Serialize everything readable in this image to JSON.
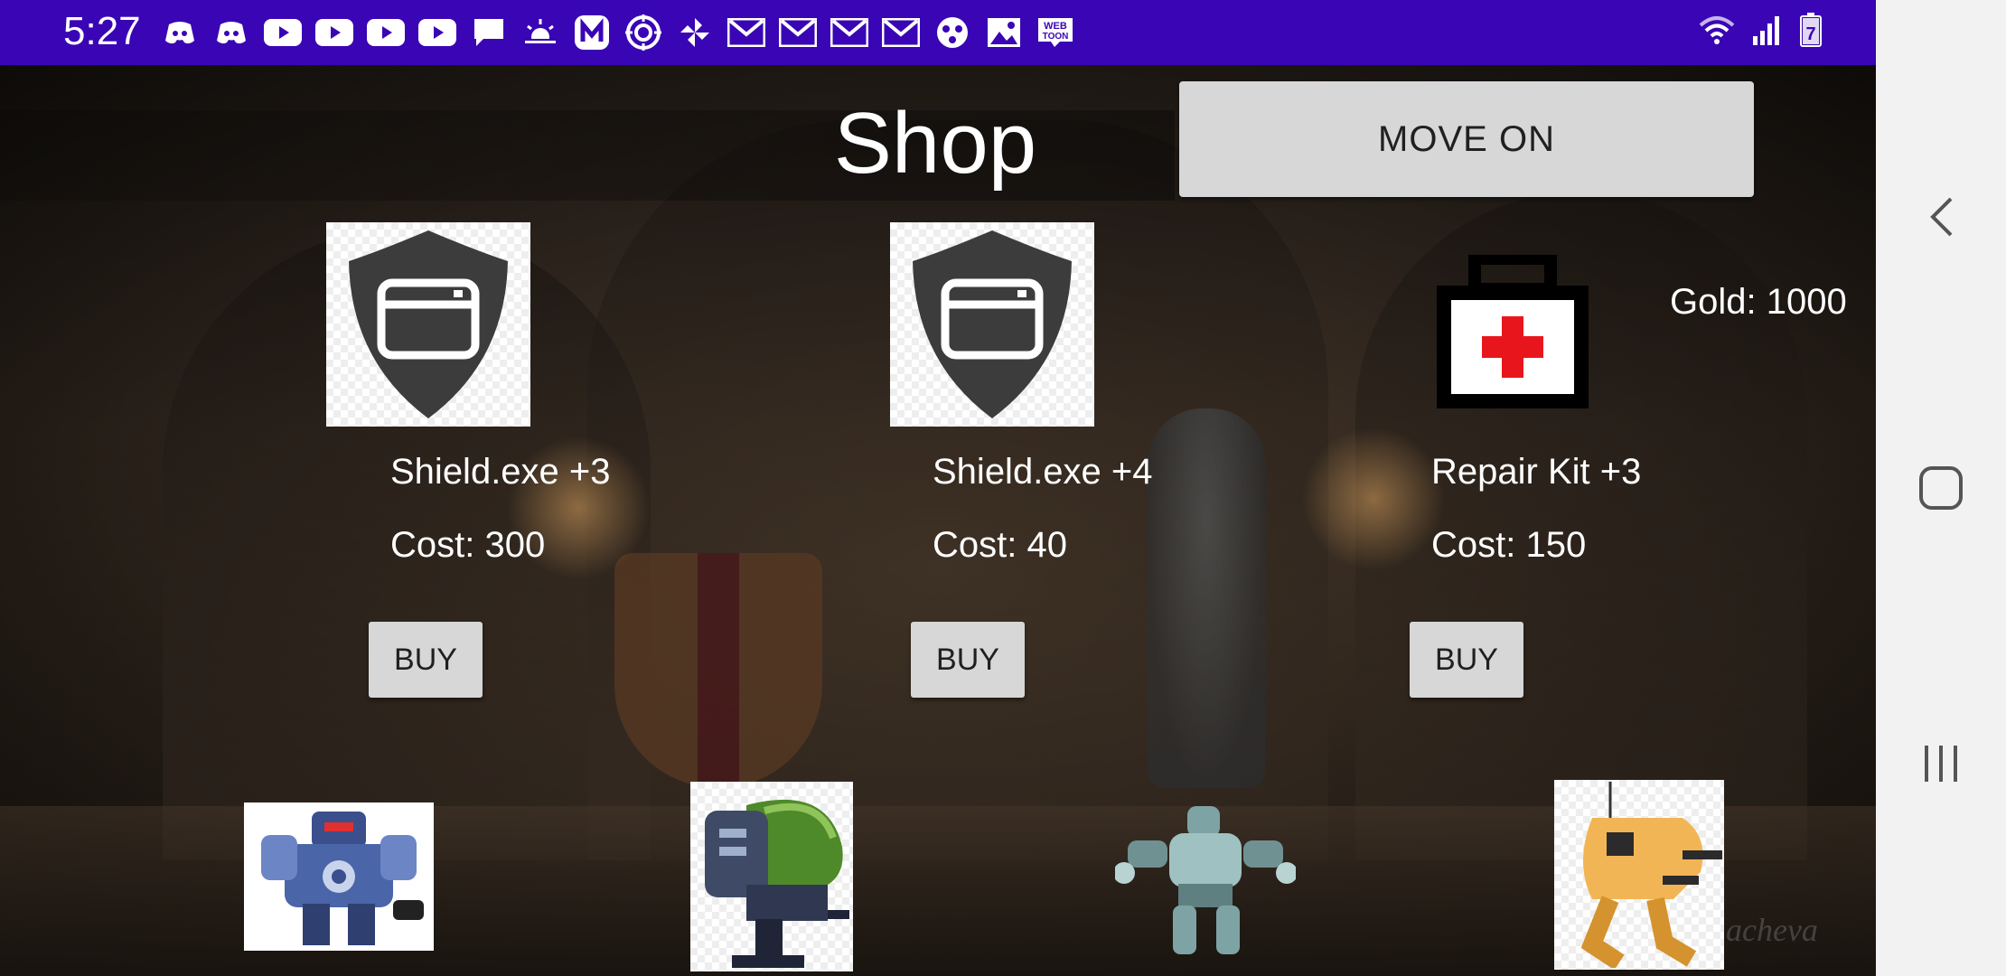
{
  "status_bar": {
    "time": "5:27",
    "notification_icons": [
      "discord-icon",
      "discord-icon",
      "youtube-icon",
      "youtube-icon",
      "youtube-icon",
      "youtube-icon",
      "message-icon",
      "weather-icon",
      "m-app-icon",
      "target-app-icon",
      "pinwheel-icon",
      "gmail-icon",
      "gmail-icon",
      "gmail-icon",
      "gmail-icon",
      "game-icon",
      "gallery-icon",
      "webtoon-icon"
    ],
    "webtoon_text": "WEB TOON",
    "battery_level": "7"
  },
  "shop": {
    "title": "Shop",
    "move_on_label": "MOVE ON",
    "gold_text": "Gold: 1000",
    "items": [
      {
        "icon": "shield-icon",
        "name": "Shield.exe +3",
        "cost": "Cost: 300",
        "buy_label": "BUY"
      },
      {
        "icon": "shield-icon",
        "name": "Shield.exe +4",
        "cost": "Cost: 40",
        "buy_label": "BUY"
      },
      {
        "icon": "repair-kit-icon",
        "name": "Repair Kit +3",
        "cost": "Cost: 150",
        "buy_label": "BUY"
      }
    ]
  },
  "party": [
    "blue-mech-robot",
    "green-dome-mech-robot",
    "steel-humanoid-robot",
    "yellow-walker-mech-robot"
  ],
  "watermark": "acheva",
  "colors": {
    "status_bar": "#3a05b5",
    "button_bg": "#d6d7d6",
    "nav_bar": "#f2f2f2"
  }
}
